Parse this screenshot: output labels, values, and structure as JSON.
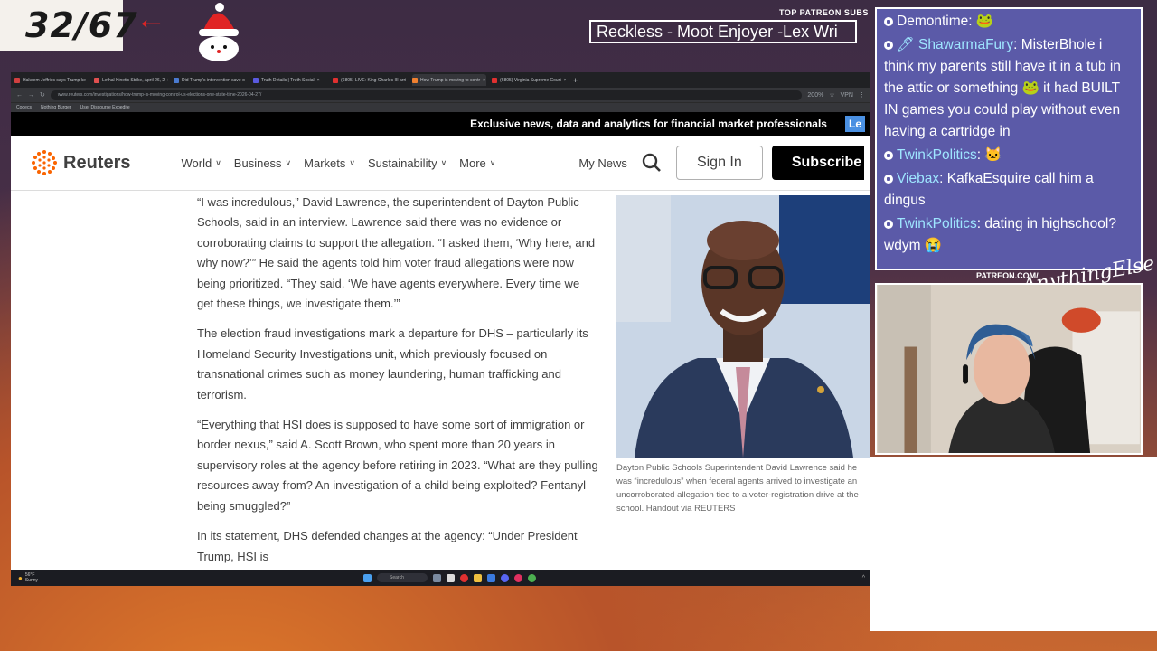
{
  "overlay": {
    "counter": "32/67",
    "patreon_label": "TOP PATREON SUBS",
    "patreon_ticker": "Reckless - Moot Enjoyer -Lex Wri",
    "patreon_footer": "PATREON.COM/",
    "signature": "AnythingElse"
  },
  "browser": {
    "tabs": [
      {
        "label": "Hakeem Jeffries says Trump ke",
        "color": "#d04040"
      },
      {
        "label": "Lethal Kinetic Strike, April 26, 2",
        "color": "#e05050"
      },
      {
        "label": "Did Trump's intervention save o",
        "color": "#4a7ad0"
      },
      {
        "label": "Truth Details | Truth Social",
        "color": "#5a5ae0"
      },
      {
        "label": "(6805) LIVE: King Charles III arri",
        "color": "#e03030"
      },
      {
        "label": "How Trump is moving to contr",
        "color": "#f08030"
      },
      {
        "label": "(6805) Virginia Supreme Court",
        "color": "#e03030"
      }
    ],
    "url": "www.reuters.com/investigations/how-trump-is-moving-control-us-elections-one-state-time-2026-04-27/",
    "zoom": "200%",
    "vpn": "VPN",
    "bookmarks": [
      "Codecs",
      "Nothing Burger",
      "User Discourse Expedite"
    ]
  },
  "reuters": {
    "banner_text": "Exclusive news, data and analytics for financial market professionals",
    "banner_button": "Le",
    "logo": "Reuters",
    "menu": [
      "World",
      "Business",
      "Markets",
      "Sustainability",
      "More"
    ],
    "my_news": "My News",
    "sign_in": "Sign In",
    "subscribe": "Subscribe",
    "paragraphs": [
      "“I was incredulous,” David Lawrence, the superintendent of Dayton Public Schools, said in an interview. Lawrence said there was no evidence or corroborating claims to support the allegation. “I asked them, ‘Why here, and why now?’” He said the agents told him voter fraud allegations were now being prioritized. “They said, ‘We have agents everywhere. Every time we get these things, we investigate them.’”",
      "The election fraud investigations mark a departure for DHS – particularly its Homeland Security Investigations unit, which previously focused on transnational crimes such as money laundering, human trafficking and terrorism.",
      "“Everything that HSI does is supposed to have some sort of immigration or border nexus,” said A. Scott Brown, who spent more than 20 years in supervisory roles at the agency before retiring in 2023. “What are they pulling resources away from? An investigation of a child being exploited? Fentanyl being smuggled?”",
      "In its statement, DHS defended changes at the agency: “Under President Trump, HSI is"
    ],
    "caption": "Dayton Public Schools Superintendent David Lawrence said he was “incredulous” when federal agents arrived to investigate an uncorroborated allegation tied to a voter-registration drive at the school. Handout via REUTERS"
  },
  "taskbar": {
    "temperature": "56°F",
    "weather": "Sunny",
    "search": "Search"
  },
  "chat": {
    "messages": [
      {
        "user": "Demontime",
        "text": ": 🐸",
        "user_color": "white"
      },
      {
        "user": "🖊 ShawarmaFury",
        "text": ": MisterBhole i think my parents still have it in a tub in the attic or something 🐸 it had BUILT IN games you could play without even having a cartridge in",
        "user_color": "cyan"
      },
      {
        "user": "TwinkPolitics",
        "text": ": 🐱",
        "user_color": "cyan"
      },
      {
        "user": "Viebax",
        "text": ": KafkaEsquire call him a dingus",
        "user_color": "cyan"
      },
      {
        "user": "TwinkPolitics",
        "text": ": dating in highschool? wdym 😭",
        "user_color": "cyan"
      }
    ]
  }
}
